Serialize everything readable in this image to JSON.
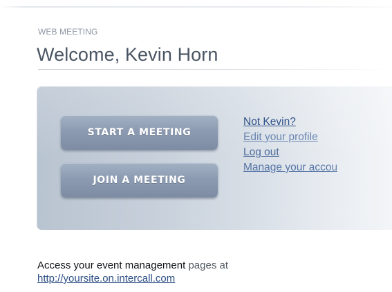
{
  "header": {
    "section_label": "WEB MEETING",
    "welcome_text": "Welcome, Kevin Horn"
  },
  "actions": {
    "start_label": "START A MEETING",
    "join_label": "JOIN A MEETING"
  },
  "account_links": [
    {
      "label": "Not Kevin?"
    },
    {
      "label": "Edit your profile"
    },
    {
      "label": "Log out"
    },
    {
      "label": "Manage your accou"
    }
  ],
  "footer": {
    "access_text_main": "Access your event management",
    "access_text_tail": " pages at",
    "site_link": "http://yoursite.on.intercall.com"
  },
  "colors": {
    "link": "#2d4f86",
    "button": "#8c9bb1",
    "heading": "#4a5563"
  }
}
